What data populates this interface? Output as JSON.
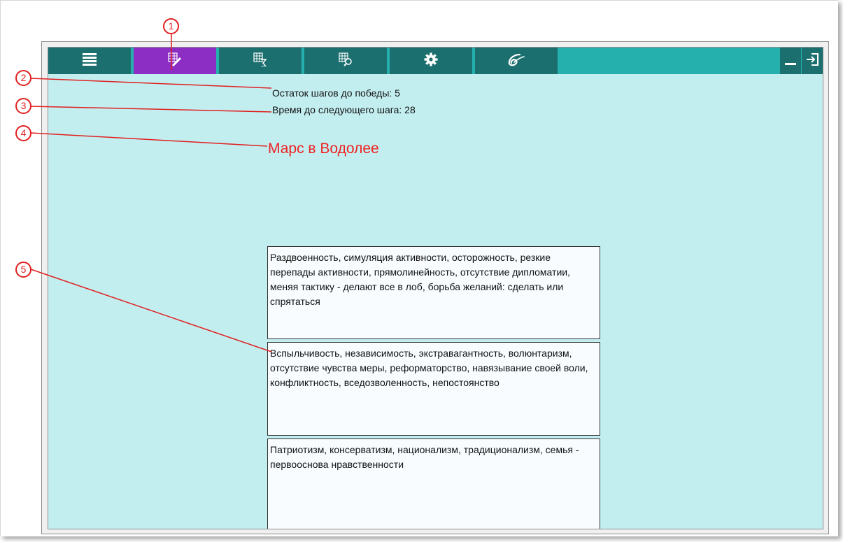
{
  "toolbar": {
    "tabs": [
      {
        "name": "menu",
        "icon": "list-icon",
        "active": false
      },
      {
        "name": "transit-edit",
        "icon": "table-edit-icon",
        "active": true
      },
      {
        "name": "table-sum",
        "icon": "table-sum-icon",
        "active": false
      },
      {
        "name": "table-search",
        "icon": "table-search-icon",
        "active": false
      },
      {
        "name": "settings",
        "icon": "gear-icon",
        "active": false
      },
      {
        "name": "logo",
        "icon": "logo-6-icon",
        "active": false
      }
    ],
    "window_buttons": [
      {
        "name": "minimize",
        "icon": "minimize-icon"
      },
      {
        "name": "exit",
        "icon": "exit-icon"
      }
    ],
    "colors": {
      "bar": "#25b0ae",
      "tab": "#1b6f6e",
      "active_tab": "#8c2dc4"
    }
  },
  "status": {
    "steps_left": "Остаток шагов до победы: 5",
    "time_to_next": "Время до следующего шага: 28"
  },
  "planet_title": "Марс в Водолее",
  "descriptions": [
    "Раздвоенность, симуляция активности, осторожность, резкие перепады активности, прямолинейность, отсутствие дипломатии, меняя тактику - делают все в лоб, борьба желаний: сделать или спрятаться",
    "Вспыльчивость, независимость, экстравагантность, волюнтаризм, отсутствие чувства меры, реформаторство, навязывание своей воли, конфликтность, вседозволенность, непостоянство",
    "Патриотизм, консерватизм, национализм, традиционализм, семья - первооснова нравственности"
  ],
  "callouts": [
    "1",
    "2",
    "3",
    "4",
    "5"
  ],
  "colors": {
    "content_bg": "#c3eef0",
    "title": "#ee2222",
    "callout": "#e02020"
  }
}
